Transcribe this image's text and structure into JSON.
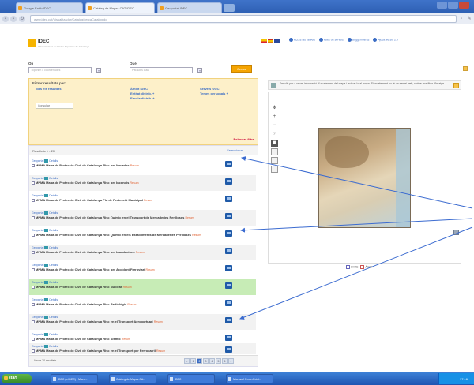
{
  "browser": {
    "tabs": [
      {
        "label": "Google Earth IDEC"
      },
      {
        "label": "Catàleg de Mapes CAT IDEC"
      },
      {
        "label": "Geoportal IDEC"
      }
    ],
    "url": "www.idec.cat/Visualitzador/Catalog/cercaCatalog.do"
  },
  "header": {
    "logo_text": "IDEC",
    "logo_sub": "Infraestructura de Dades Espacials de Catalunya",
    "links": [
      "Accés als serveis",
      "Altes de serveis",
      "Suggeriments",
      "Ajuda",
      "Versió 2.0"
    ]
  },
  "search": {
    "what_label": "Què",
    "where_label": "On",
    "what_placeholder": "Paraules clau",
    "where_placeholder": "Topònim o coordenades",
    "go_label": "Cercar"
  },
  "filters": {
    "title": "Filtrar resultats per:",
    "col1": [
      "Tots els resultats"
    ],
    "col2": [
      "Àmbit IDEC",
      "Entitat distrib. +",
      "Escala distrib. +"
    ],
    "col3": [
      "Serveis OGC",
      "Temes personals +"
    ],
    "input_value": "Consultar",
    "remove_label": "Esborrar filtre"
  },
  "results": {
    "summary": "Resultats 1 - 20",
    "select_label": "Seleccionar",
    "source_label": "Geoportal",
    "info_label": "Detalls",
    "items": [
      {
        "title": "MPMA Mapa de Protecció Civil de Catalunya Risc per Nevades",
        "date": "Resum"
      },
      {
        "title": "MPMA Mapa de Protecció Civil de Catalunya Risc per Incendis",
        "date": "Resum"
      },
      {
        "title": "MPMA Mapa de Protecció Civil de Catalunya Pla de Protecció Municipal",
        "date": "Resum"
      },
      {
        "title": "MPMA Mapa de Protecció Civil de Catalunya Risc Químic en el Transport de Mercaderies Perilloses",
        "date": "Resum"
      },
      {
        "title": "MPMA Mapa de Protecció Civil de Catalunya Risc Químic en els Establiments de Mercaderies Perilloses",
        "date": "Resum"
      },
      {
        "title": "MPMA Mapa de Protecció Civil de Catalunya Risc per Inundacions",
        "date": "Resum"
      },
      {
        "title": "MPMA Mapa de Protecció Civil de Catalunya Risc per Accident Ferroviari",
        "date": "Resum"
      },
      {
        "title": "MPMA Mapa de Protecció Civil de Catalunya Risc Nuclear",
        "date": "Resum"
      },
      {
        "title": "MPMA Mapa de Protecció Civil de Catalunya Risc Radiològic",
        "date": "Resum"
      },
      {
        "title": "MPMA Mapa de Protecció Civil de Catalunya Risc en el Transport Aeroportuari",
        "date": "Resum"
      },
      {
        "title": "MPMA Mapa de Protecció Civil de Catalunya Risc Sísmic",
        "date": "Resum"
      },
      {
        "title": "MPMA Mapa de Protecció Civil de Catalunya Risc en el Transport per Ferrocarril",
        "date": "Resum"
      }
    ],
    "per_page": "Veure 20 resultats",
    "pages": [
      "«",
      "1",
      "2",
      "3",
      "4",
      "5",
      "6",
      "»"
    ]
  },
  "map": {
    "bar_text": "Fer clic per a veure informació d'un element del mapa i activar-lo al mapa. Si un element no té un servei web, s'obre una fitxa d'imatge",
    "legend": [
      "Límits",
      "Àmbit"
    ]
  },
  "taskbar": {
    "start_label": "start",
    "tasks": [
      "IDEC (a IDEC) - Micro...",
      "Catàleg de Mapes CA...",
      "IDEC",
      "Microsoft PowerPoint..."
    ],
    "clock": "17:16"
  }
}
